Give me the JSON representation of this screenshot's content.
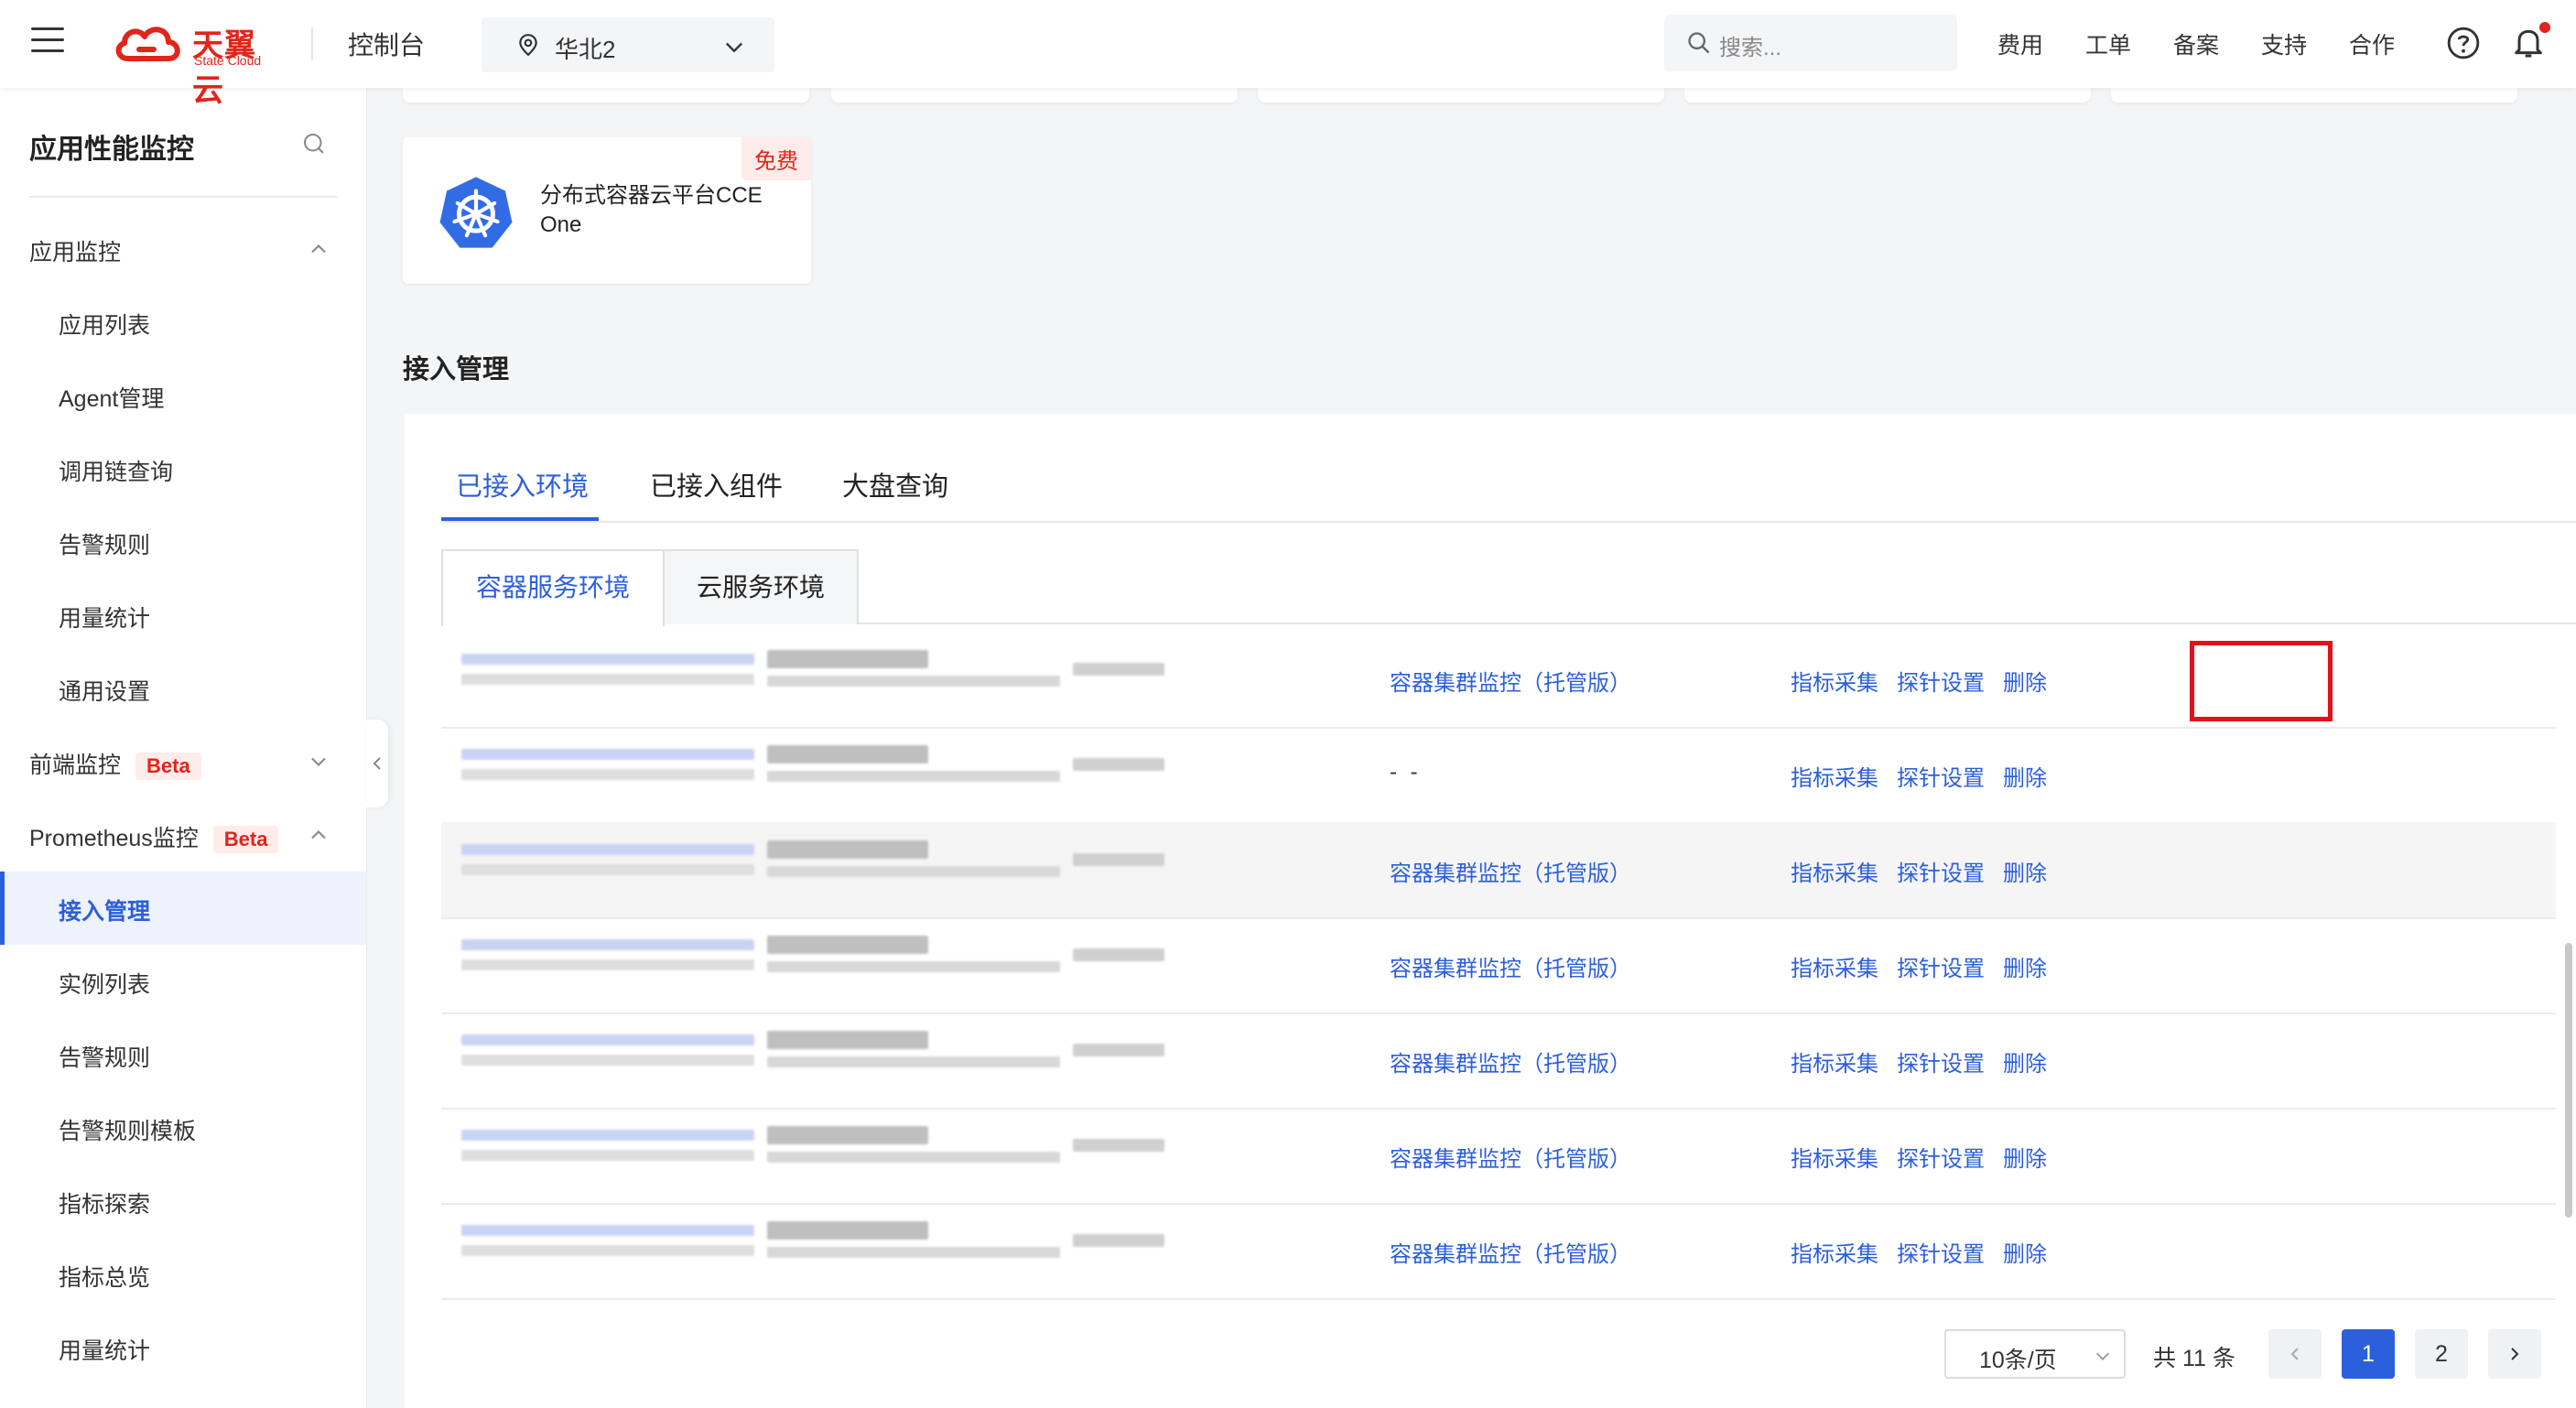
{
  "topbar": {
    "logo_text": "天翼云",
    "logo_sub": "State Cloud",
    "console": "控制台",
    "region": "华北2",
    "search_placeholder": "搜索...",
    "links": [
      "费用",
      "工单",
      "备案",
      "支持",
      "合作"
    ]
  },
  "sidebar": {
    "title": "应用性能监控",
    "groups": [
      {
        "label": "应用监控",
        "expanded": true,
        "items": [
          "应用列表",
          "Agent管理",
          "调用链查询",
          "告警规则",
          "用量统计",
          "通用设置"
        ]
      },
      {
        "label": "前端监控",
        "badge": "Beta",
        "expanded": false
      },
      {
        "label": "Prometheus监控",
        "badge": "Beta",
        "expanded": true,
        "items": [
          "接入管理",
          "实例列表",
          "告警规则",
          "告警规则模板",
          "指标探索",
          "指标总览",
          "用量统计"
        ]
      }
    ],
    "active_item": "接入管理"
  },
  "product_card": {
    "name": "分布式容器云平台CCE One",
    "badge": "免费"
  },
  "section_title": "接入管理",
  "tabs": [
    "已接入环境",
    "已接入组件",
    "大盘查询"
  ],
  "active_tab": "已接入环境",
  "subtabs": [
    "容器服务环境",
    "云服务环境"
  ],
  "active_subtab": "容器服务环境",
  "rows": [
    {
      "type": "容器集群监控（托管版）",
      "actions": [
        "指标采集",
        "探针设置",
        "删除"
      ]
    },
    {
      "type": "- -",
      "actions": [
        "指标采集",
        "探针设置",
        "删除"
      ]
    },
    {
      "type": "容器集群监控（托管版）",
      "actions": [
        "指标采集",
        "探针设置",
        "删除"
      ]
    },
    {
      "type": "容器集群监控（托管版）",
      "actions": [
        "指标采集",
        "探针设置",
        "删除"
      ]
    },
    {
      "type": "容器集群监控（托管版）",
      "actions": [
        "指标采集",
        "探针设置",
        "删除"
      ]
    },
    {
      "type": "容器集群监控（托管版）",
      "actions": [
        "指标采集",
        "探针设置",
        "删除"
      ]
    },
    {
      "type": "容器集群监控（托管版）",
      "actions": [
        "指标采集",
        "探针设置",
        "删除"
      ]
    }
  ],
  "pagination": {
    "page_size": "10条/页",
    "total": "共 11 条",
    "pages": [
      "1",
      "2"
    ],
    "current_page": "1"
  },
  "colors": {
    "accent": "#2c5fdb",
    "brand": "#e1251b",
    "highlight": "#e1121c"
  }
}
